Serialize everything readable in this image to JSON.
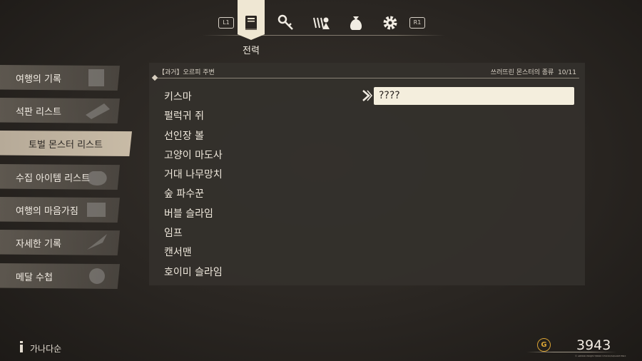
{
  "top_tabs": {
    "prev_button": "L1",
    "next_button": "R1",
    "active_label": "전력",
    "tabs": [
      "battle-record-book-icon",
      "key-icon",
      "party-icon",
      "bag-icon",
      "gear-icon"
    ]
  },
  "sidebar": {
    "items": [
      {
        "label": "여행의 기록"
      },
      {
        "label": "석판 리스트"
      },
      {
        "label": "토벌 몬스터 리스트"
      },
      {
        "label": "수집 아이템 리스트"
      },
      {
        "label": "여행의 마음가짐"
      },
      {
        "label": "자세한 기록"
      },
      {
        "label": "메달 수첩"
      }
    ],
    "active_index": 2
  },
  "panel": {
    "breadcrumb": "【과거】오르피 주변",
    "count_label": "쓰러뜨린 몬스터의 종류",
    "count_value": "10/11",
    "monsters": [
      "키스마",
      "펄럭귀 쥐",
      "선인장 볼",
      "고양이 마도사",
      "거대 나무망치",
      "숲 파수꾼",
      "버블 슬라임",
      "임프",
      "캔서맨",
      "호이미 슬라임"
    ],
    "selected_detail": "????"
  },
  "footer": {
    "sort_label": "가나다순",
    "gold_symbol": "G",
    "gold_amount": "3943",
    "copyright": "© ARMOR PROJECT/BIRD STUDIO/SQUARE ENIX"
  },
  "colors": {
    "accent_cream": "#efe7d3",
    "gold": "#d9a334"
  }
}
